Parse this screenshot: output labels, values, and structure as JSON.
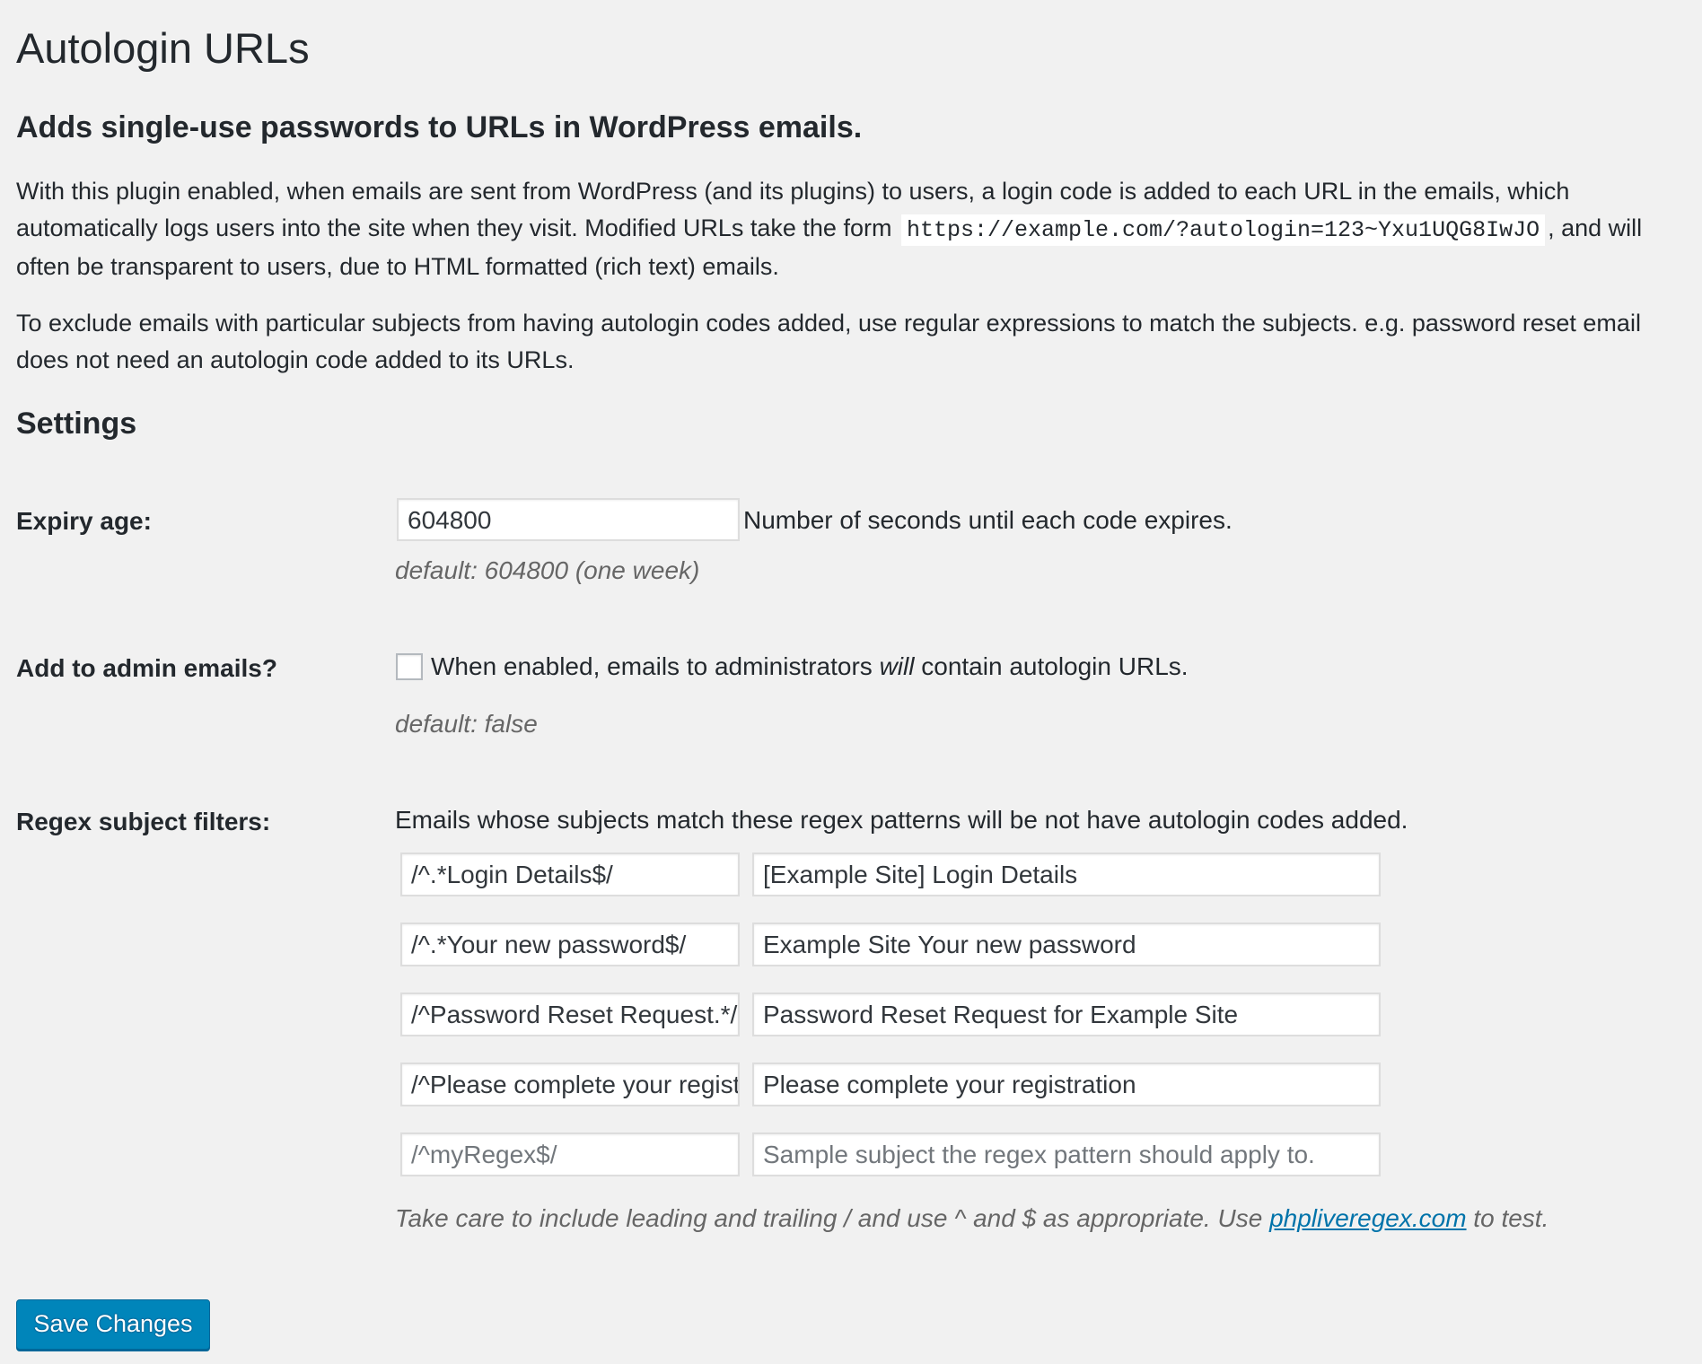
{
  "page": {
    "title": "Autologin URLs",
    "subtitle": "Adds single-use passwords to URLs in WordPress emails."
  },
  "intro": {
    "para1_a": "With this plugin enabled, when emails are sent from WordPress (and its plugins) to users, a login code is added to each URL in the emails, which automatically logs users into the site when they visit. Modified URLs take the form",
    "para1_code": "https://example.com/?autologin=123~Yxu1UQG8IwJO",
    "para1_b": ", and will often be transparent to users, due to HTML formatted (rich text) emails.",
    "para2": "To exclude emails with particular subjects from having autologin codes added, use regular expressions to match the subjects. e.g. password reset email does not need an autologin code added to its URLs."
  },
  "settings": {
    "heading": "Settings",
    "expiry": {
      "label": "Expiry age:",
      "value": "604800",
      "description": "Number of seconds until each code expires.",
      "hint": "default: 604800 (one week)"
    },
    "admin": {
      "label": "Add to admin emails?",
      "checked": false,
      "desc_before": "When enabled, emails to administrators ",
      "desc_emphasis": "will",
      "desc_after": " contain autologin URLs.",
      "hint": "default: false"
    },
    "regex": {
      "label": "Regex subject filters:",
      "intro": "Emails whose subjects match these regex patterns will be not have autologin codes added.",
      "rows": [
        {
          "pattern": "/^.*Login Details$/",
          "sample": "[Example Site] Login Details"
        },
        {
          "pattern": "/^.*Your new password$/",
          "sample": "Example Site Your new password"
        },
        {
          "pattern": "/^Password Reset Request.*/",
          "sample": "Password Reset Request for Example Site"
        },
        {
          "pattern": "/^Please complete your registration/",
          "sample": "Please complete your registration"
        }
      ],
      "new_row": {
        "pattern_placeholder": "/^myRegex$/",
        "sample_placeholder": "Sample subject the regex pattern should apply to."
      },
      "note_before": "Take care to include leading and trailing / and use ^ and $ as appropriate. Use ",
      "note_link": "phpliveregex.com",
      "note_after": " to test."
    }
  },
  "actions": {
    "save_label": "Save Changes"
  },
  "colors": {
    "background": "#f1f1f1",
    "primary_button": "#0085ba",
    "link": "#0073aa"
  }
}
